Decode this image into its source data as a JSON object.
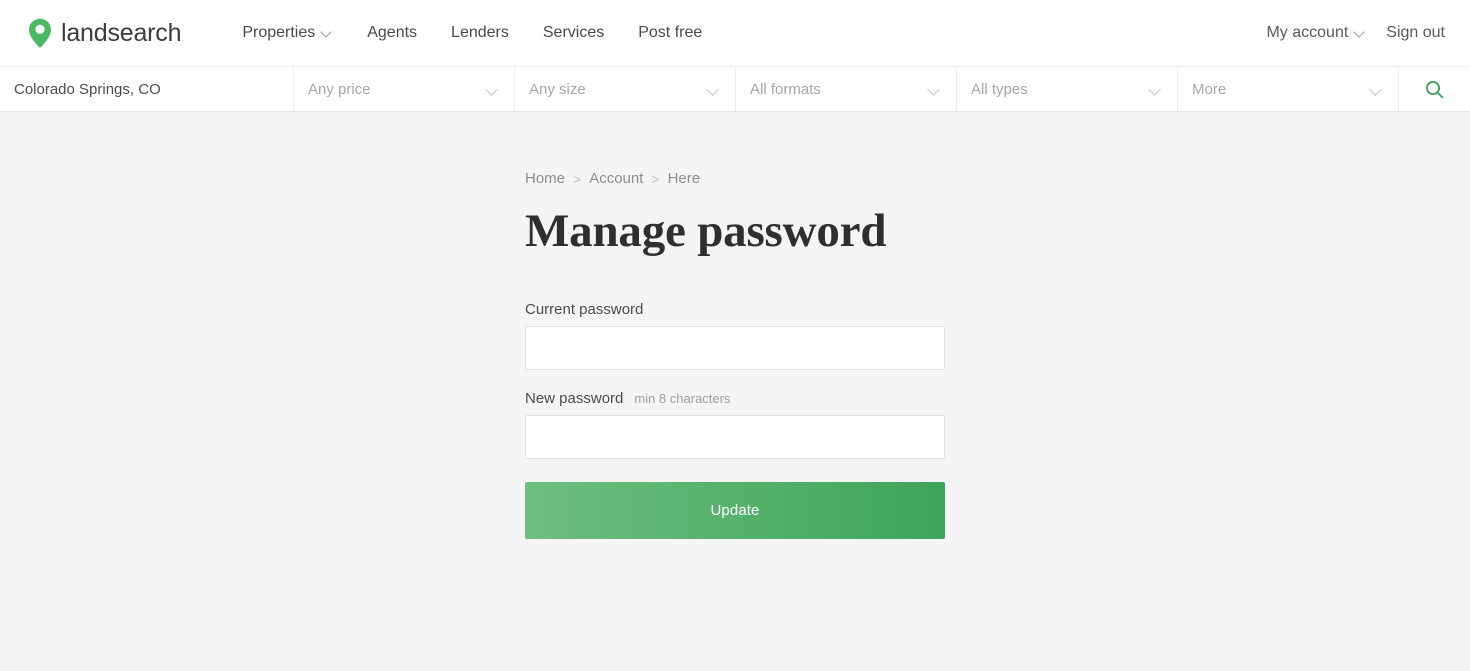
{
  "brand": {
    "name": "landsearch",
    "logo_color": "#4cb963",
    "logo_icon": "map-pin-icon"
  },
  "header": {
    "nav": [
      {
        "label": "Properties",
        "has_dropdown": true
      },
      {
        "label": "Agents",
        "has_dropdown": false
      },
      {
        "label": "Lenders",
        "has_dropdown": false
      },
      {
        "label": "Services",
        "has_dropdown": false
      },
      {
        "label": "Post free",
        "has_dropdown": false
      }
    ],
    "account": [
      {
        "label": "My account",
        "has_dropdown": true
      },
      {
        "label": "Sign out",
        "has_dropdown": false
      }
    ]
  },
  "filterbar": {
    "location": {
      "value": "Colorado Springs, CO",
      "placeholder": "Location"
    },
    "filters": [
      {
        "label": "Any price"
      },
      {
        "label": "Any size"
      },
      {
        "label": "All formats"
      },
      {
        "label": "All types"
      },
      {
        "label": "More"
      }
    ],
    "search_icon": "search-icon",
    "search_icon_color": "#3f9e5a"
  },
  "main": {
    "breadcrumb": [
      {
        "label": "Home"
      },
      {
        "label": "Account"
      },
      {
        "label": "Here"
      }
    ],
    "breadcrumb_separator": ">",
    "title": "Manage password",
    "fields": [
      {
        "label": "Current password",
        "hint": "",
        "value": "",
        "placeholder": ""
      },
      {
        "label": "New password",
        "hint": "min 8 characters",
        "value": "",
        "placeholder": ""
      }
    ],
    "submit_label": "Update",
    "submit_gradient_from": "#6ebe80",
    "submit_gradient_to": "#3da559"
  }
}
